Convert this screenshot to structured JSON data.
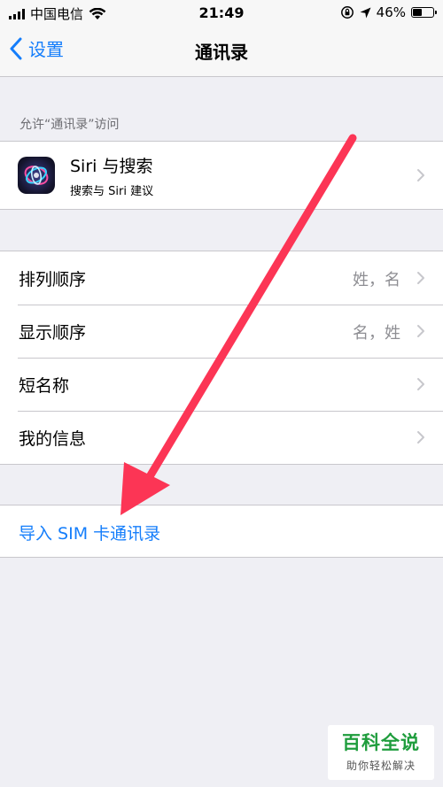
{
  "status_bar": {
    "carrier": "中国电信",
    "time": "21:49",
    "battery_percent": "46%",
    "battery_level": 0.46,
    "icons": [
      "signal-icon",
      "wifi-icon",
      "orientation-lock-icon",
      "location-icon",
      "battery-icon"
    ]
  },
  "nav": {
    "back_label": "设置",
    "title": "通讯录"
  },
  "section_header": "允许“通讯录”访问",
  "siri": {
    "title": "Siri 与搜索",
    "subtitle": "搜索与 Siri 建议"
  },
  "settings": [
    {
      "label": "排列顺序",
      "value": "姓，名"
    },
    {
      "label": "显示顺序",
      "value": "名，姓"
    },
    {
      "label": "短名称",
      "value": ""
    },
    {
      "label": "我的信息",
      "value": ""
    }
  ],
  "import_sim": "导入 SIM 卡通讯录",
  "annotation": {
    "color": "#fc3555"
  },
  "watermark": {
    "title": "百科全说",
    "subtitle": "助你轻松解决"
  },
  "colors": {
    "accent": "#157efb",
    "background": "#efeff4",
    "separator": "#c8c7cc",
    "secondary_text": "#8e8e93"
  }
}
